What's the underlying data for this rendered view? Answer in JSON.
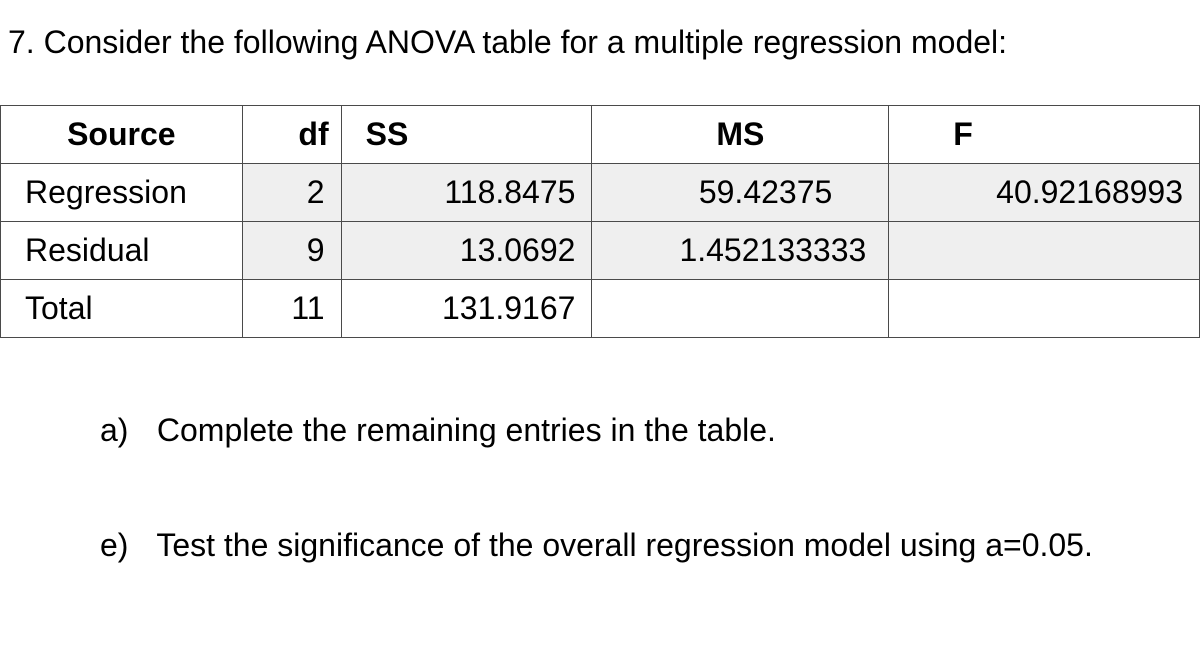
{
  "question": {
    "number": "7.",
    "text": "Consider the following ANOVA table for a multiple regression model:"
  },
  "table": {
    "headers": {
      "source": "Source",
      "df": "df",
      "ss": "SS",
      "ms": "MS",
      "f": "F"
    },
    "rows": [
      {
        "source": "Regression",
        "df": "2",
        "ss": "118.8475",
        "ms": "59.42375",
        "f": "40.92168993",
        "shaded": true
      },
      {
        "source": "Residual",
        "df": "9",
        "ss": "13.0692",
        "ms": "1.452133333",
        "f": "",
        "shaded": true
      },
      {
        "source": "Total",
        "df": "11",
        "ss": "131.9167",
        "ms": "",
        "f": "",
        "shaded": false
      }
    ]
  },
  "subitems": {
    "a": {
      "label": "a)",
      "text": "Complete the remaining entries in the table."
    },
    "e": {
      "label": "e)",
      "text": "Test the significance of the overall regression model using a=0.05."
    }
  },
  "chart_data": {
    "type": "table",
    "title": "ANOVA table for a multiple regression model",
    "columns": [
      "Source",
      "df",
      "SS",
      "MS",
      "F"
    ],
    "rows": [
      [
        "Regression",
        2,
        118.8475,
        59.42375,
        40.92168993
      ],
      [
        "Residual",
        9,
        13.0692,
        1.452133333,
        null
      ],
      [
        "Total",
        11,
        131.9167,
        null,
        null
      ]
    ]
  }
}
